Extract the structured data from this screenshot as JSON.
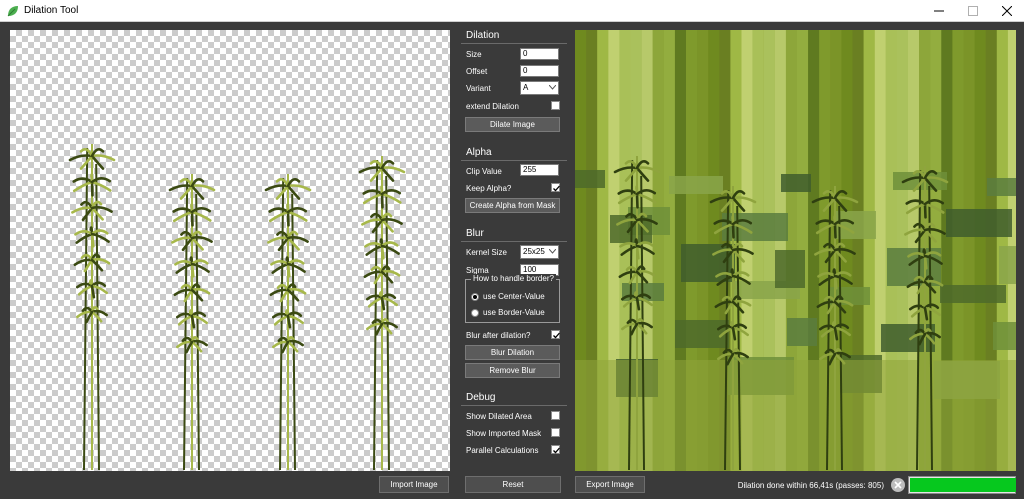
{
  "window": {
    "title": "Dilation Tool",
    "icon": "leaf-icon",
    "controls": [
      "minimize-icon",
      "maximize-icon",
      "close-icon"
    ]
  },
  "dilation": {
    "title": "Dilation",
    "size_label": "Size",
    "size_value": "0",
    "offset_label": "Offset",
    "offset_value": "0",
    "variant_label": "Variant",
    "variant_value": "A",
    "extend_label": "extend Dilation",
    "extend_checked": false,
    "dilate_button": "Dilate Image"
  },
  "alpha": {
    "title": "Alpha",
    "clip_label": "Clip Value",
    "clip_value": "255",
    "keep_label": "Keep Alpha?",
    "keep_checked": true,
    "create_button": "Create Alpha from Mask"
  },
  "blur": {
    "title": "Blur",
    "kernel_label": "Kernel Size",
    "kernel_value": "25x25",
    "sigma_label": "Sigma",
    "sigma_value": "100",
    "border_group_title": "How to handle border?",
    "border_options": [
      "use Center-Value",
      "use Border-Value"
    ],
    "border_selected": 0,
    "after_label": "Blur after dilation?",
    "after_checked": true,
    "blur_button": "Blur Dilation",
    "remove_button": "Remove Blur"
  },
  "debug": {
    "title": "Debug",
    "show_dilated_label": "Show Dilated Area",
    "show_dilated_checked": false,
    "show_mask_label": "Show Imported Mask",
    "show_mask_checked": false,
    "parallel_label": "Parallel Calculations",
    "parallel_checked": true
  },
  "bottom": {
    "import_button": "Import Image",
    "reset_button": "Reset",
    "export_button": "Export Image",
    "status_text": "Dilation done within 66,41s (passes: 805)",
    "progress": 1.0,
    "progress_color": "#06c81e",
    "cancel_icon": "cancel-icon"
  },
  "colors": {
    "background": "#3a3a3a",
    "button": "#5b5b5b",
    "plant_dark": "#3b4a12",
    "plant_light": "#a7b84a",
    "dilated_bg": "#7c8f25"
  }
}
